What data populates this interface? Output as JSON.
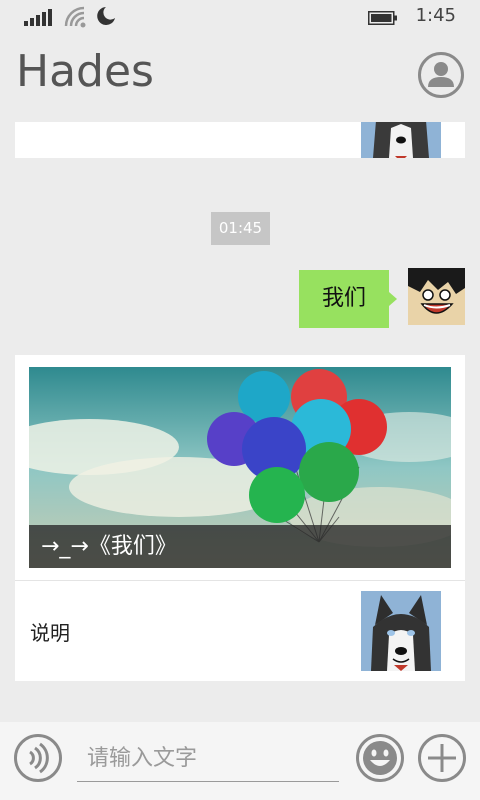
{
  "status_bar": {
    "time": "1:45",
    "icons": [
      "signal-icon",
      "wifi-icon",
      "moon-icon",
      "battery-icon"
    ]
  },
  "header": {
    "title": "Hades",
    "profile_icon": "person-icon"
  },
  "messages": {
    "timestamp": "01:45",
    "outgoing_text": "我们"
  },
  "article": {
    "caption": "→_→《我们》",
    "description": "说明",
    "image": "balloons-image"
  },
  "input": {
    "placeholder": "请输入文字",
    "value": ""
  },
  "colors": {
    "background": "#ececec",
    "bubble_green": "#97e15f",
    "timestamp_gray": "#c6c6c6",
    "icon_gray": "#8a8a8a"
  }
}
